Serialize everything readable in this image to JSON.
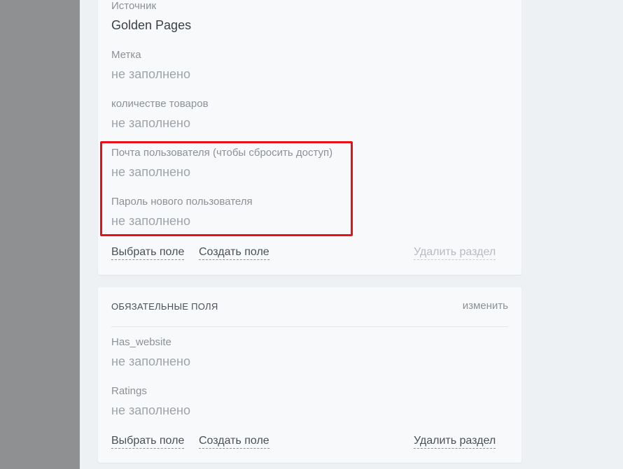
{
  "section_top": {
    "fields": [
      {
        "label": "Источник",
        "value": "Golden Pages"
      },
      {
        "label": "Метка",
        "value": "не заполнено"
      },
      {
        "label": "количестве товаров",
        "value": "не заполнено"
      },
      {
        "label": "Почта пользователя (чтобы сбросить доступ)",
        "value": "не заполнено"
      },
      {
        "label": "Пароль нового пользователя",
        "value": "не заполнено"
      }
    ],
    "actions": {
      "select_field": "Выбрать поле",
      "create_field": "Создать поле",
      "delete_section": "Удалить раздел"
    }
  },
  "section_required": {
    "title": "ОБЯЗАТЕЛЬНЫЕ ПОЛЯ",
    "edit_label": "изменить",
    "fields": [
      {
        "label": "Has_website",
        "value": "не заполнено"
      },
      {
        "label": "Ratings",
        "value": "не заполнено"
      }
    ],
    "actions": {
      "select_field": "Выбрать поле",
      "create_field": "Создать поле",
      "delete_section": "Удалить раздел"
    }
  },
  "colors": {
    "highlight": "#e8101a",
    "sidebar": "#8e9092",
    "card": "#f8f9fb",
    "background": "#eef1f4"
  }
}
